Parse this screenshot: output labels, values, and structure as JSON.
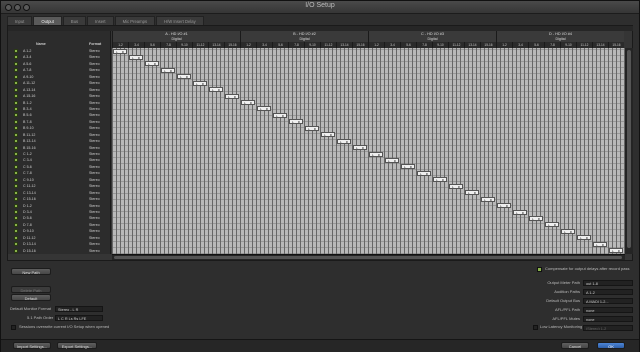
{
  "window": {
    "title": "I/O Setup"
  },
  "tabs": [
    "Input",
    "Output",
    "Bus",
    "Insert",
    "Mic Preamps",
    "H/W Insert Delay"
  ],
  "active_tab": 1,
  "table": {
    "col_name": "Name",
    "col_format": "Format",
    "devices": [
      {
        "name": "A - HD I/O #1",
        "sub": "Digital"
      },
      {
        "name": "B - HD I/O #2",
        "sub": "Digital"
      },
      {
        "name": "C - HD I/O #3",
        "sub": "Digital"
      },
      {
        "name": "D - HD I/O #4",
        "sub": "Digital"
      }
    ],
    "channels": [
      "1-2",
      "3-4",
      "5-6",
      "7-8",
      "9-10",
      "11-12",
      "13-14",
      "15-16"
    ],
    "rows": [
      {
        "name": "A 1-2",
        "format": "Stereo"
      },
      {
        "name": "A 3-4",
        "format": "Stereo"
      },
      {
        "name": "A 5-6",
        "format": "Stereo"
      },
      {
        "name": "A 7-8",
        "format": "Stereo"
      },
      {
        "name": "A 9-10",
        "format": "Stereo"
      },
      {
        "name": "A 11-12",
        "format": "Stereo"
      },
      {
        "name": "A 13-14",
        "format": "Stereo"
      },
      {
        "name": "A 15-16",
        "format": "Stereo"
      },
      {
        "name": "B 1-2",
        "format": "Stereo"
      },
      {
        "name": "B 3-4",
        "format": "Stereo"
      },
      {
        "name": "B 5-6",
        "format": "Stereo"
      },
      {
        "name": "B 7-8",
        "format": "Stereo"
      },
      {
        "name": "B 9-10",
        "format": "Stereo"
      },
      {
        "name": "B 11-12",
        "format": "Stereo"
      },
      {
        "name": "B 13-14",
        "format": "Stereo"
      },
      {
        "name": "B 15-16",
        "format": "Stereo"
      },
      {
        "name": "C 1-2",
        "format": "Stereo"
      },
      {
        "name": "C 3-4",
        "format": "Stereo"
      },
      {
        "name": "C 5-6",
        "format": "Stereo"
      },
      {
        "name": "C 7-8",
        "format": "Stereo"
      },
      {
        "name": "C 9-10",
        "format": "Stereo"
      },
      {
        "name": "C 11-12",
        "format": "Stereo"
      },
      {
        "name": "C 13-14",
        "format": "Stereo"
      },
      {
        "name": "C 15-16",
        "format": "Stereo"
      },
      {
        "name": "D 1-2",
        "format": "Stereo"
      },
      {
        "name": "D 3-4",
        "format": "Stereo"
      },
      {
        "name": "D 5-6",
        "format": "Stereo"
      },
      {
        "name": "D 7-8",
        "format": "Stereo"
      },
      {
        "name": "D 9-10",
        "format": "Stereo"
      },
      {
        "name": "D 11-12",
        "format": "Stereo"
      },
      {
        "name": "D 13-14",
        "format": "Stereo"
      },
      {
        "name": "D 15-16",
        "format": "Stereo"
      }
    ],
    "mark_l": "L",
    "mark_r": "R"
  },
  "left": {
    "new_path": "New Path",
    "delete_path": "Delete Path",
    "default": "Default",
    "default_monitor_label": "Default Monitor Format",
    "default_monitor_value": "Stereo - L R",
    "path_order_label": "5.1 Path Order",
    "path_order_value": "L C R Ls Rs LFE",
    "sessions_override": "Sessions overwrite current I/O Setup when opened"
  },
  "right": {
    "compensate": "Compensate for output delays after record pass",
    "output_meter_label": "Output Meter Path",
    "output_meter_value": "out 1-8",
    "audition_label": "Audition Paths",
    "audition_value": "A 1-2",
    "default_output_label": "Default Output Bus",
    "default_output_value": "A MADI 1-2...",
    "afl_path_label": "AFL/PFL Path",
    "afl_path_value": "none",
    "afl_mutes_label": "AFL/PFL Mutes",
    "afl_mutes_value": "none",
    "low_latency_label": "Low Latency Monitoring",
    "low_latency_value": "(Stereo) 1-2"
  },
  "bottom": {
    "import": "Import Settings...",
    "export": "Export Settings...",
    "cancel": "Cancel",
    "ok": "OK"
  },
  "colors": {
    "accent": "#2f5fa8",
    "check": "#8ab34a"
  }
}
